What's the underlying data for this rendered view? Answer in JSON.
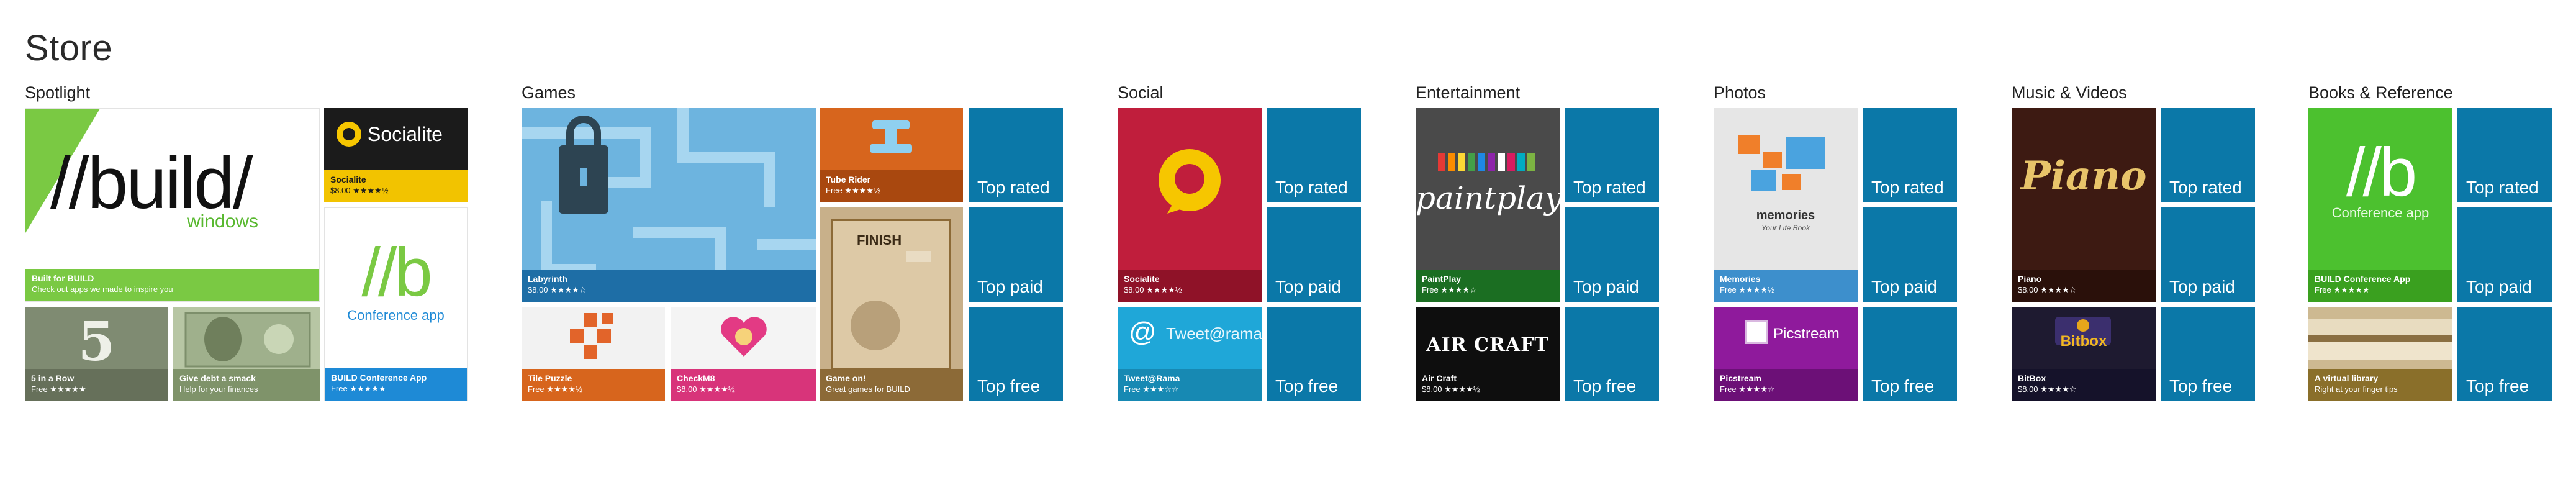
{
  "page": {
    "title": "Store"
  },
  "colors": {
    "nav_tile": "#0b78a8",
    "build_green": "#7ac943",
    "bar_blue": "#1e6ea6",
    "bar_orange": "#d7651d",
    "bar_pink": "#d8347a",
    "bar_brown": "#8c6a37",
    "socialite_red": "#c01e3c",
    "twitter_cyan": "#1fa7d8",
    "paintplay_bg": "#4a4a4a",
    "piano_bg": "#3d1a12",
    "picstream_purple": "#8f1a9c",
    "conference_green": "#4cc12f"
  },
  "groups": {
    "spotlight": {
      "title": "Spotlight",
      "build": {
        "logo": "//build/",
        "sub": "windows",
        "name": "Built for BUILD",
        "meta": "Check out apps we made to inspire you"
      },
      "socialite": {
        "logo": "Socialite",
        "name": "Socialite",
        "meta": "$8.00 ★★★★½"
      },
      "conference": {
        "logo": "//b",
        "sub": "Conference app",
        "name": "BUILD Conference App",
        "meta": "Free ★★★★★"
      },
      "five": {
        "logo": "5",
        "name": "5 in a Row",
        "meta": "Free ★★★★★"
      },
      "smack": {
        "name": "Give debt a smack",
        "meta": "Help for your finances"
      }
    },
    "games": {
      "title": "Games",
      "labyrinth": {
        "name": "Labyrinth",
        "meta": "$8.00 ★★★★☆"
      },
      "tube": {
        "name": "Tube Rider",
        "meta": "Free ★★★★½"
      },
      "gameon": {
        "overlay": "FINISH",
        "name": "Game on!",
        "meta": "Great games for BUILD"
      },
      "tile_puzzle": {
        "name": "Tile Puzzle",
        "meta": "Free ★★★★½"
      },
      "checkm8": {
        "name": "CheckM8",
        "meta": "$8.00 ★★★★½"
      },
      "nav": [
        "Top rated",
        "Top paid",
        "Top free"
      ]
    },
    "social": {
      "title": "Social",
      "socialite": {
        "name": "Socialite",
        "meta": "$8.00 ★★★★½"
      },
      "tweet": {
        "logo": "Tweet@rama",
        "name": "Tweet@Rama",
        "meta": "Free ★★★☆☆"
      },
      "nav": [
        "Top rated",
        "Top paid",
        "Top free"
      ]
    },
    "entertainment": {
      "title": "Entertainment",
      "paintplay": {
        "logo": "paintplay",
        "name": "PaintPlay",
        "meta": "Free ★★★★☆"
      },
      "aircraft": {
        "logo": "AIR CRAFT",
        "name": "Air Craft",
        "meta": "$8.00 ★★★★½"
      },
      "nav": [
        "Top rated",
        "Top paid",
        "Top free"
      ]
    },
    "photos": {
      "title": "Photos",
      "memories": {
        "logo": "memories",
        "sub": "Your Life Book",
        "name": "Memories",
        "meta": "Free ★★★★½"
      },
      "picstream": {
        "logo": "Picstream",
        "name": "Picstream",
        "meta": "Free ★★★★☆"
      },
      "nav": [
        "Top rated",
        "Top paid",
        "Top free"
      ]
    },
    "music": {
      "title": "Music & Videos",
      "piano": {
        "logo": "Piano",
        "name": "Piano",
        "meta": "$8.00 ★★★★☆"
      },
      "bitbox": {
        "logo": "Bitbox",
        "name": "BitBox",
        "meta": "$8.00 ★★★★☆"
      },
      "nav": [
        "Top rated",
        "Top paid",
        "Top free"
      ]
    },
    "books": {
      "title": "Books & Reference",
      "conference": {
        "logo": "//b",
        "sub": "Conference app",
        "name": "BUILD Conference App",
        "meta": "Free ★★★★★"
      },
      "library": {
        "name": "A virtual library",
        "meta": "Right at your finger tips"
      },
      "nav": [
        "Top rated",
        "Top paid",
        "Top free"
      ]
    }
  }
}
